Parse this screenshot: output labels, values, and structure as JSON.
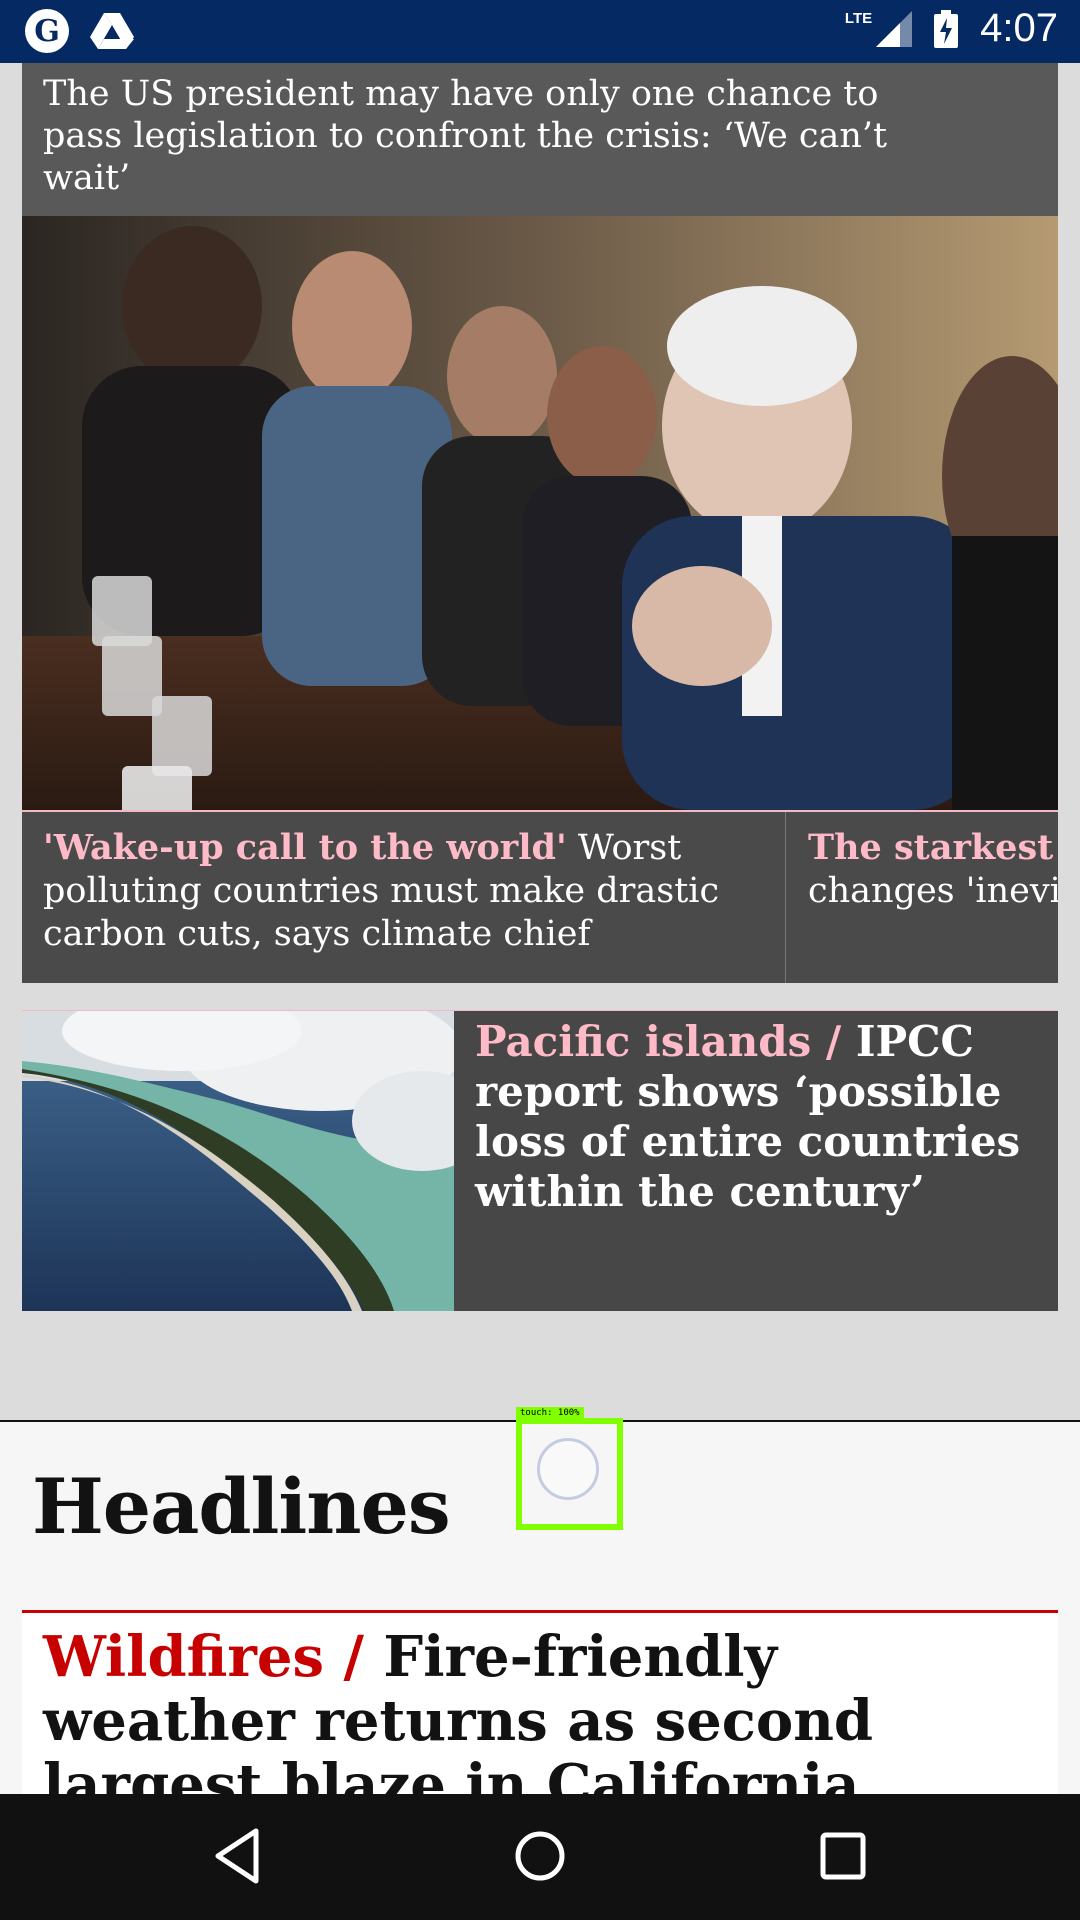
{
  "status_bar": {
    "time": "4:07",
    "network": "LTE",
    "icons": [
      "guardian-logo-icon",
      "drive-icon",
      "signal-icon",
      "battery-charging-icon"
    ],
    "background_color": "#052962"
  },
  "top_card": {
    "trail_text": "The US president may have only one chance to pass legislation to confront the crisis: ‘We can’t wait’"
  },
  "carousel": {
    "items": [
      {
        "kicker": "'Wake-up call to the world'",
        "headline": " Worst polluting countries must make drastic carbon cuts, says climate chief"
      },
      {
        "kicker": "The starkest w",
        "headline": "changes 'inevita"
      }
    ]
  },
  "pacific_card": {
    "kicker": "Pacific islands /",
    "headline": " IPCC report shows ‘possible loss of entire countries within the century’"
  },
  "headlines_section": {
    "title": "Headlines"
  },
  "wildfire_card": {
    "kicker": "Wildfires /",
    "headline": " Fire-friendly weather returns as second largest blaze in California history burns"
  },
  "touch_overlay": {
    "label": "touch: 100%"
  },
  "nav_bar": {
    "buttons": [
      "back-icon",
      "home-icon",
      "recents-icon"
    ]
  },
  "colors": {
    "accent_pink": "#ffbac8",
    "news_red": "#c70000",
    "card_dark": "#474747"
  }
}
